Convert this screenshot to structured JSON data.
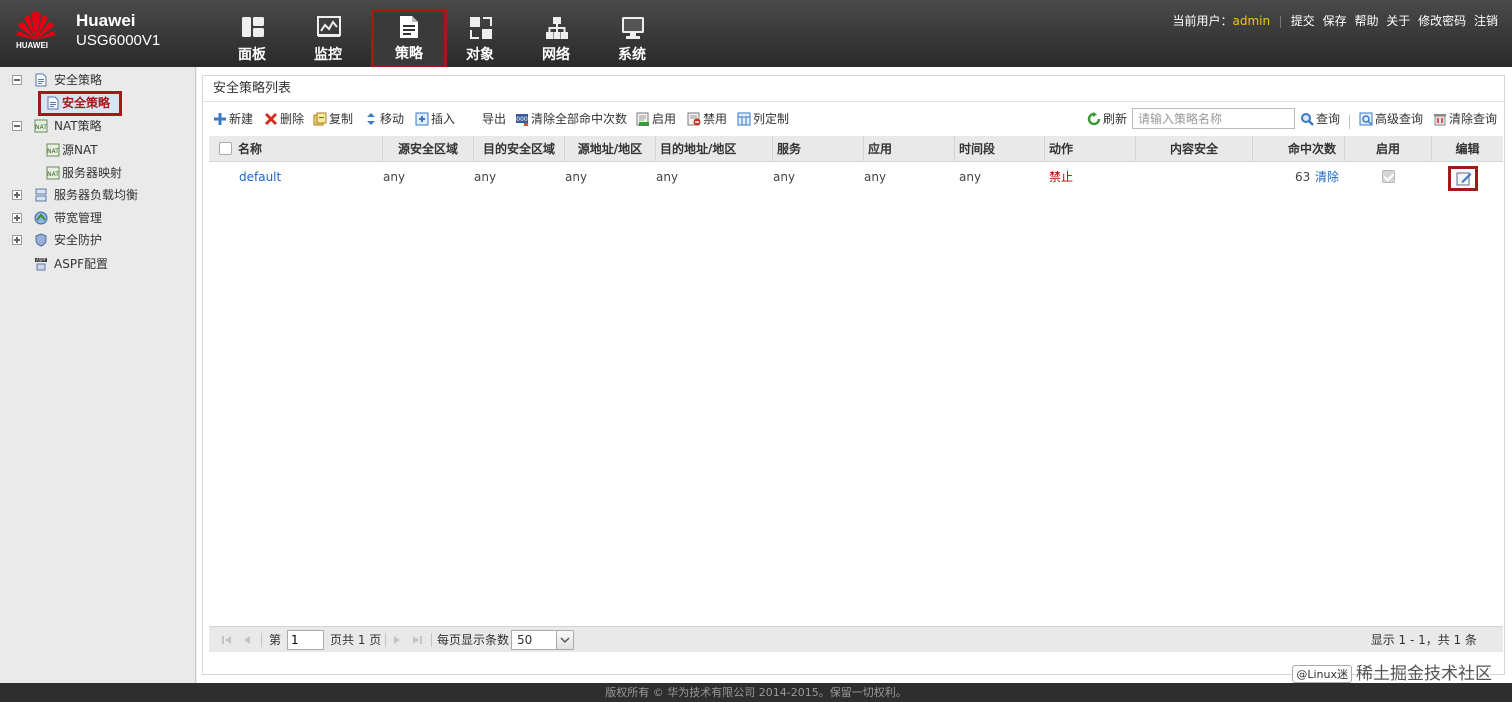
{
  "header": {
    "brand_mark": "HUAWEI",
    "vendor": "Huawei",
    "model": "USG6000V1",
    "nav": [
      {
        "label": "面板",
        "icon": "dashboard-icon"
      },
      {
        "label": "监控",
        "icon": "monitor-chart-icon"
      },
      {
        "label": "策略",
        "icon": "policy-document-icon",
        "active": true
      },
      {
        "label": "对象",
        "icon": "object-icon"
      },
      {
        "label": "网络",
        "icon": "network-icon"
      },
      {
        "label": "系统",
        "icon": "system-monitor-icon"
      }
    ],
    "current_user_label": "当前用户：",
    "current_user": "admin",
    "links": [
      "提交",
      "保存",
      "帮助",
      "关于",
      "修改密码",
      "注销"
    ]
  },
  "sidebar": {
    "items": [
      {
        "label": "安全策略",
        "level": 0,
        "toggle": "minus"
      },
      {
        "label": "安全策略",
        "level": 1,
        "selected": true
      },
      {
        "label": "NAT策略",
        "level": 0,
        "toggle": "minus"
      },
      {
        "label": "源NAT",
        "level": 1
      },
      {
        "label": "服务器映射",
        "level": 1
      },
      {
        "label": "服务器负载均衡",
        "level": 0,
        "toggle": "plus"
      },
      {
        "label": "带宽管理",
        "level": 0,
        "toggle": "plus"
      },
      {
        "label": "安全防护",
        "level": 0,
        "toggle": "plus"
      },
      {
        "label": "ASPF配置",
        "level": 0
      }
    ]
  },
  "panel": {
    "title": "安全策略列表"
  },
  "toolbar": {
    "new": "新建",
    "delete": "删除",
    "copy": "复制",
    "move": "移动",
    "insert": "插入",
    "export": "导出",
    "clear_hits": "清除全部命中次数",
    "enable": "启用",
    "disable": "禁用",
    "customize_columns": "列定制",
    "refresh": "刷新",
    "search_placeholder": "请输入策略名称",
    "search": "查询",
    "advanced_search": "高级查询",
    "clear_search": "清除查询"
  },
  "grid": {
    "columns": [
      "名称",
      "源安全区域",
      "目的安全区域",
      "源地址/地区",
      "目的地址/地区",
      "服务",
      "应用",
      "时间段",
      "动作",
      "内容安全",
      "命中次数",
      "启用",
      "编辑"
    ],
    "rows": [
      {
        "name": "default",
        "src_zone": "any",
        "dst_zone": "any",
        "src_addr": "any",
        "dst_addr": "any",
        "service": "any",
        "application": "any",
        "schedule": "any",
        "action": "禁止",
        "content_security": "",
        "hits": "63",
        "clear_label": "清除",
        "enabled": true
      }
    ]
  },
  "pager": {
    "page_prefix": "第",
    "page_value": "1",
    "page_suffix": "页共 1 页",
    "page_size_label": "每页显示条数",
    "page_size": "50",
    "summary": "显示 1 - 1，共 1 条"
  },
  "footer": {
    "copyright": "版权所有 © 华为技术有限公司 2014-2015。保留一切权利。"
  },
  "watermark": {
    "badge": "@Linux迷",
    "text": "稀土掘金技术社区"
  }
}
